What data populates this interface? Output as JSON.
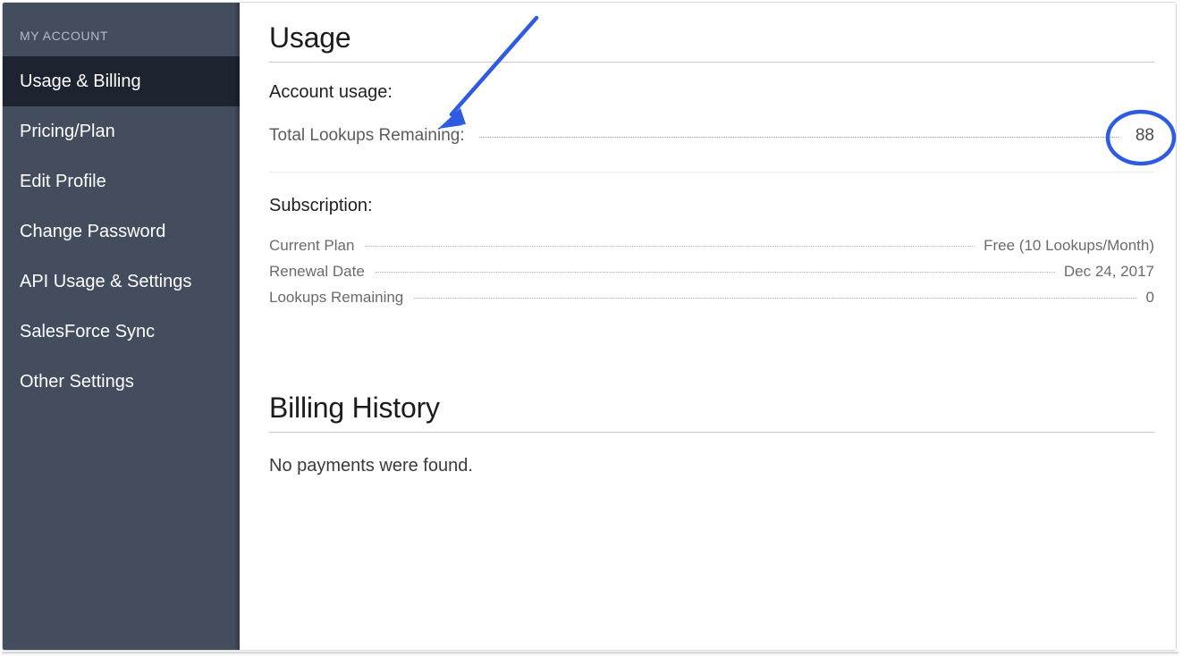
{
  "sidebar": {
    "title": "MY ACCOUNT",
    "items": [
      {
        "label": "Usage & Billing",
        "active": true
      },
      {
        "label": "Pricing/Plan",
        "active": false
      },
      {
        "label": "Edit Profile",
        "active": false
      },
      {
        "label": "Change Password",
        "active": false
      },
      {
        "label": "API Usage & Settings",
        "active": false
      },
      {
        "label": "SalesForce Sync",
        "active": false
      },
      {
        "label": "Other Settings",
        "active": false
      }
    ]
  },
  "usage": {
    "heading": "Usage",
    "account_usage_label": "Account usage:",
    "total_lookups_label": "Total Lookups Remaining:",
    "total_lookups_value": "88"
  },
  "subscription": {
    "heading": "Subscription:",
    "rows": [
      {
        "label": "Current Plan",
        "value": "Free (10 Lookups/Month)"
      },
      {
        "label": "Renewal Date",
        "value": "Dec 24, 2017"
      },
      {
        "label": "Lookups Remaining",
        "value": "0"
      }
    ]
  },
  "billing_history": {
    "heading": "Billing History",
    "empty_message": "No payments were found."
  },
  "annotations": {
    "color": "#2f5be0",
    "arrow_name": "blue-arrow-annotation",
    "ellipse_name": "blue-ellipse-annotation"
  }
}
